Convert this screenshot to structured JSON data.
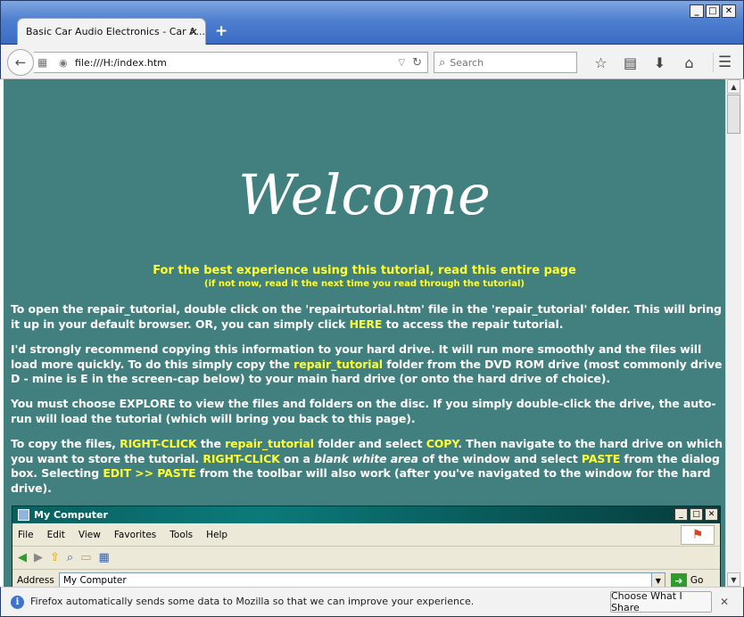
{
  "window": {
    "tab_title": "Basic Car Audio Electronics - Car A...",
    "tab_close": "✕",
    "new_tab": "+",
    "minimize": "_",
    "maximize": "□",
    "close": "✕"
  },
  "navbar": {
    "url": "file:///H:/index.htm",
    "search_placeholder": "Search"
  },
  "page": {
    "welcome": "Welcome",
    "intro_main": "For the best experience using this tutorial, read this entire page",
    "intro_sub": "(if not now, read it the next time you read through the tutorial)",
    "p1_a": "To open the repair_tutorial, double click on the 'repairtutorial.htm' file in the 'repair_tutorial' folder. This will bring it up in your default browser. OR, you can simply click ",
    "p1_link": "HERE",
    "p1_b": " to access the repair tutorial.",
    "p2_a": "I'd strongly recommend copying this information to your hard drive. It will run more smoothly and the files will load more quickly. To do this simply copy the ",
    "p2_hl": "repair_tutorial",
    "p2_b": " folder from the DVD ROM drive (most commonly drive D - mine is E in the screen-cap below) to your main hard drive (or onto the hard drive of choice).",
    "p3": "You must choose EXPLORE to view the files and folders on the disc. If you simply double-click the drive, the auto-run will load the tutorial (which will bring you back to this page).",
    "p4_a": "To copy the files, ",
    "p4_hl1": "RIGHT-CLICK",
    "p4_b": " the ",
    "p4_hl2": "repair_tutorial",
    "p4_c": " folder and select ",
    "p4_hl3": "COPY",
    "p4_d": ". Then navigate to the hard drive on which you want to store the tutorial. ",
    "p4_hl4": "RIGHT-CLICK",
    "p4_e": " on a ",
    "p4_it": "blank white area",
    "p4_f": " of the window and select ",
    "p4_hl5": "PASTE",
    "p4_g": " from the dialog box. Selecting ",
    "p4_hl6": "EDIT >> PASTE",
    "p4_h": " from the toolbar will also work (after you've navigated to the window for the hard drive)."
  },
  "mycomputer": {
    "title": "My Computer",
    "menu": [
      "File",
      "Edit",
      "View",
      "Favorites",
      "Tools",
      "Help"
    ],
    "address_label": "Address",
    "address_value": "My Computer",
    "go_label": "Go"
  },
  "notification": {
    "text": "Firefox automatically sends some data to Mozilla so that we can improve your experience.",
    "button": "Choose What I Share",
    "close": "✕"
  }
}
